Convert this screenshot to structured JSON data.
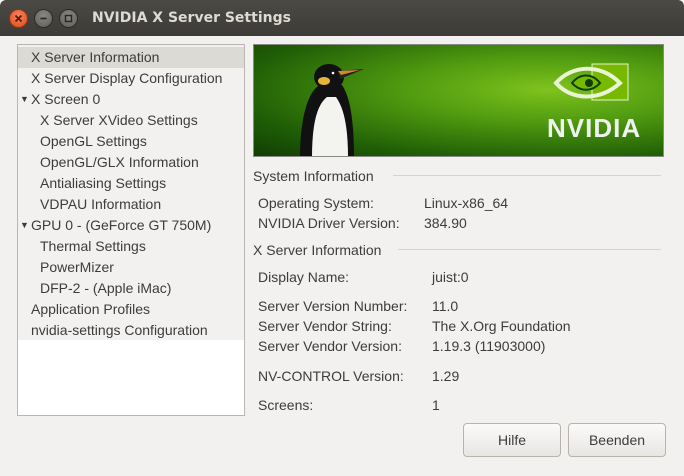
{
  "window": {
    "title": "NVIDIA X Server Settings",
    "controls": [
      "close-icon",
      "minimize-icon",
      "maximize-icon"
    ]
  },
  "sidebar": {
    "items": [
      {
        "label": "X Server Information",
        "selected": true,
        "expandable": false
      },
      {
        "label": "X Server Display Configuration",
        "selected": false,
        "expandable": false
      },
      {
        "label": "X Screen 0",
        "selected": false,
        "expandable": true,
        "expanded": true
      },
      {
        "label": "X Server XVideo Settings",
        "selected": false,
        "expandable": false
      },
      {
        "label": "OpenGL Settings",
        "selected": false,
        "expandable": false
      },
      {
        "label": "OpenGL/GLX Information",
        "selected": false,
        "expandable": false
      },
      {
        "label": "Antialiasing Settings",
        "selected": false,
        "expandable": false
      },
      {
        "label": "VDPAU Information",
        "selected": false,
        "expandable": false
      },
      {
        "label": "GPU 0 - (GeForce GT 750M)",
        "selected": false,
        "expandable": true,
        "expanded": true
      },
      {
        "label": "Thermal Settings",
        "selected": false,
        "expandable": false
      },
      {
        "label": "PowerMizer",
        "selected": false,
        "expandable": false
      },
      {
        "label": "DFP-2 - (Apple iMac)",
        "selected": false,
        "expandable": false
      },
      {
        "label": "Application Profiles",
        "selected": false,
        "expandable": false
      },
      {
        "label": "nvidia-settings Configuration",
        "selected": false,
        "expandable": false
      }
    ]
  },
  "banner": {
    "logo_text": "NVIDIA",
    "brand_color": "#76b900"
  },
  "system_info": {
    "heading": "System Information",
    "rows": [
      {
        "label": "Operating System:",
        "value": "Linux-x86_64"
      },
      {
        "label": "NVIDIA Driver Version:",
        "value": "384.90"
      }
    ]
  },
  "xserver_info": {
    "heading": "X Server Information",
    "rows": [
      {
        "label": "Display Name:",
        "value": "juist:0"
      },
      {
        "label": "Server Version Number:",
        "value": "11.0"
      },
      {
        "label": "Server Vendor String:",
        "value": "The X.Org Foundation"
      },
      {
        "label": "Server Vendor Version:",
        "value": "1.19.3 (11903000)"
      },
      {
        "label": "NV-CONTROL Version:",
        "value": "1.29"
      },
      {
        "label": "Screens:",
        "value": "1"
      }
    ]
  },
  "buttons": {
    "help": "Hilfe",
    "quit": "Beenden"
  }
}
